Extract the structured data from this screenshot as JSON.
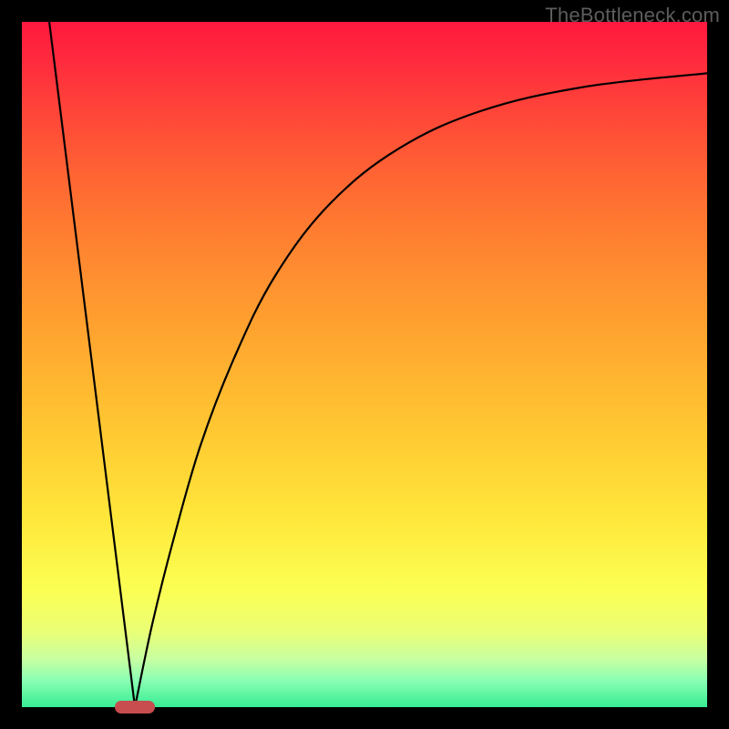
{
  "watermark": "TheBottleneck.com",
  "chart_data": {
    "type": "line",
    "title": "",
    "xlabel": "",
    "ylabel": "",
    "xlim": [
      0,
      100
    ],
    "ylim": [
      0,
      100
    ],
    "series": [
      {
        "name": "left-line",
        "points": [
          {
            "x": 4.0,
            "y": 100.0
          },
          {
            "x": 16.5,
            "y": 0.0
          }
        ]
      },
      {
        "name": "right-curve",
        "points": [
          {
            "x": 16.5,
            "y": 0.0
          },
          {
            "x": 19.0,
            "y": 12.0
          },
          {
            "x": 22.0,
            "y": 24.0
          },
          {
            "x": 26.0,
            "y": 38.0
          },
          {
            "x": 31.0,
            "y": 51.0
          },
          {
            "x": 37.0,
            "y": 63.0
          },
          {
            "x": 45.0,
            "y": 73.5
          },
          {
            "x": 55.0,
            "y": 81.5
          },
          {
            "x": 67.0,
            "y": 87.0
          },
          {
            "x": 82.0,
            "y": 90.5
          },
          {
            "x": 100.0,
            "y": 92.5
          }
        ]
      }
    ],
    "marker": {
      "x_center": 16.5,
      "y": 0.0,
      "width": 5.8
    },
    "gradient_stops": [
      {
        "pos": 0,
        "color": "#ff183f"
      },
      {
        "pos": 50,
        "color": "#ffc431"
      },
      {
        "pos": 83,
        "color": "#fbff53"
      },
      {
        "pos": 100,
        "color": "#37ec94"
      }
    ]
  }
}
